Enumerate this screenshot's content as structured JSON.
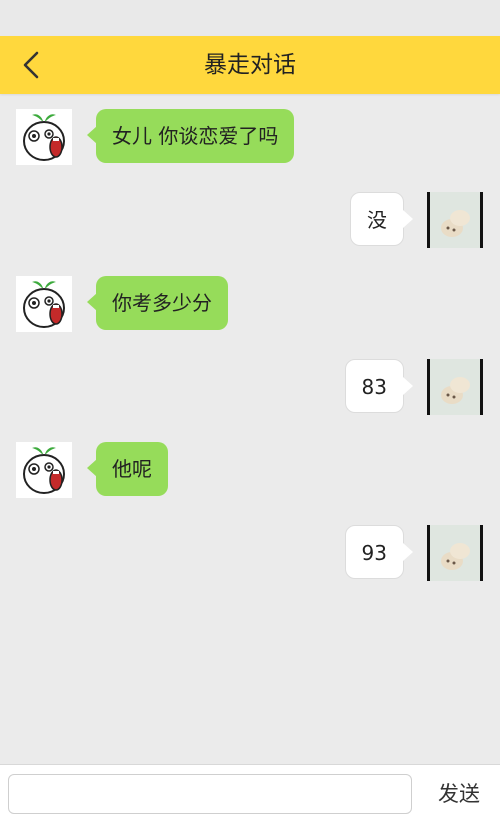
{
  "header": {
    "title": "暴走对话",
    "back_icon": "chevron-left-icon"
  },
  "colors": {
    "header_bg": "#ffd83d",
    "bubble_incoming": "#96dc5a",
    "bubble_outgoing": "#ffffff",
    "background": "#ebebeb"
  },
  "messages": [
    {
      "sender": "other",
      "avatar": "rage-face-avatar",
      "text": "女儿 你谈恋爱了吗"
    },
    {
      "sender": "self",
      "avatar": "cat-photo-avatar",
      "text": "没"
    },
    {
      "sender": "other",
      "avatar": "rage-face-avatar",
      "text": "你考多少分"
    },
    {
      "sender": "self",
      "avatar": "cat-photo-avatar",
      "text": "83"
    },
    {
      "sender": "other",
      "avatar": "rage-face-avatar",
      "text": "他呢"
    },
    {
      "sender": "self",
      "avatar": "cat-photo-avatar",
      "text": "93"
    }
  ],
  "composer": {
    "input_value": "",
    "send_label": "发送"
  }
}
